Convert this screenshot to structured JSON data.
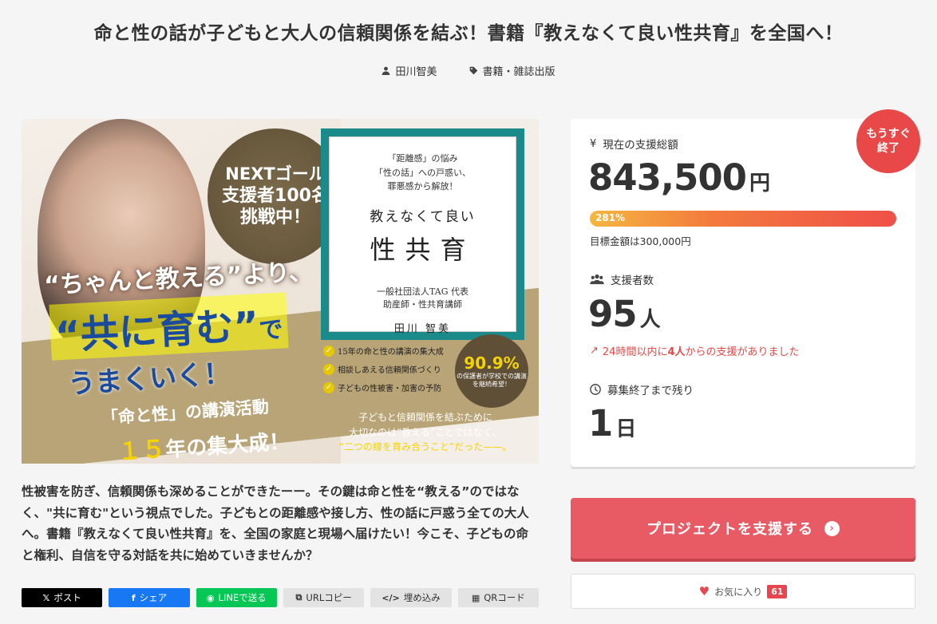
{
  "page_title": "命と性の話が子どもと大人の信頼関係を結ぶ！書籍『教えなくて良い性共育』を全国へ！",
  "meta": {
    "owner": "田川智美",
    "category": "書籍・雑誌出版"
  },
  "hero": {
    "next_line1": "NEXTゴール",
    "next_line2": "支援者100名",
    "next_line3": "挑戦中！",
    "text1": "“ちゃんと教える”より、",
    "text2": "“共に育む”",
    "text2_suffix": "で",
    "text3": "うまくいく！",
    "text4": "「命と性」の講演活動",
    "text5_num": "１５",
    "text5_rest": "年の集大成！",
    "book_lines": [
      "「距離感」の悩み",
      "「性の話」への戸惑い、",
      "罪悪感から解放！"
    ],
    "book_subtitle": "教えなくて良い",
    "book_title": "性共育",
    "book_author_role1": "一般社団法人TAG 代表",
    "book_author_role2": "助産師・性共育講師",
    "book_author": "田川 智美",
    "checks": [
      "15年の命と性の講演の集大成",
      "相談しあえる信頼関係づくり",
      "子どもの性被害・加害の予防"
    ],
    "badge_pct": "90.9%",
    "badge_text": "の保護者が学校での講演を継続希望！",
    "bottom_line1": "子どもと信頼関係を結ぶために",
    "bottom_line2": "大切なのは“教える”ことではなく、",
    "bottom_line3": "“二つの線を育み合うこと”だった——。"
  },
  "description": "性被害を防ぎ、信頼関係も深めることができたーー。その鍵は命と性を“教える”のではなく、\"共に育む\"という視点でした。子どもとの距離感や接し方、性の話に戸惑う全ての大人へ。書籍『教えなくて良い性共育』を、全国の家庭と現場へ届けたい！今こそ、子どもの命と権利、自信を守る対話を共に始めていきませんか？",
  "share": {
    "x": "ポスト",
    "facebook": "シェア",
    "line": "LINEで送る",
    "url_copy": "URLコピー",
    "embed": "埋め込み",
    "qr": "QRコード"
  },
  "stats": {
    "soon_line1": "もうすぐ",
    "soon_line2": "終了",
    "total_label": "現在の支援総額",
    "total_value": "843,500",
    "total_unit": "円",
    "progress_label": "281%",
    "progress_percent": 281,
    "goal_text": "目標金額は300,000円",
    "supporters_label": "支援者数",
    "supporters_value": "95",
    "supporters_unit": "人",
    "trend_prefix": "24時間以内に",
    "trend_count": "4人",
    "trend_suffix": "からの支援がありました",
    "remaining_label": "募集終了まで残り",
    "remaining_value": "1",
    "remaining_unit": "日"
  },
  "support_button": "プロジェクトを支援する",
  "favorite": {
    "label": "お気に入り",
    "count": "61"
  },
  "colors": {
    "accent": "#e85a64",
    "badge_red": "#e84848",
    "progress_start": "#f4b740",
    "progress_end": "#ef4f48"
  }
}
